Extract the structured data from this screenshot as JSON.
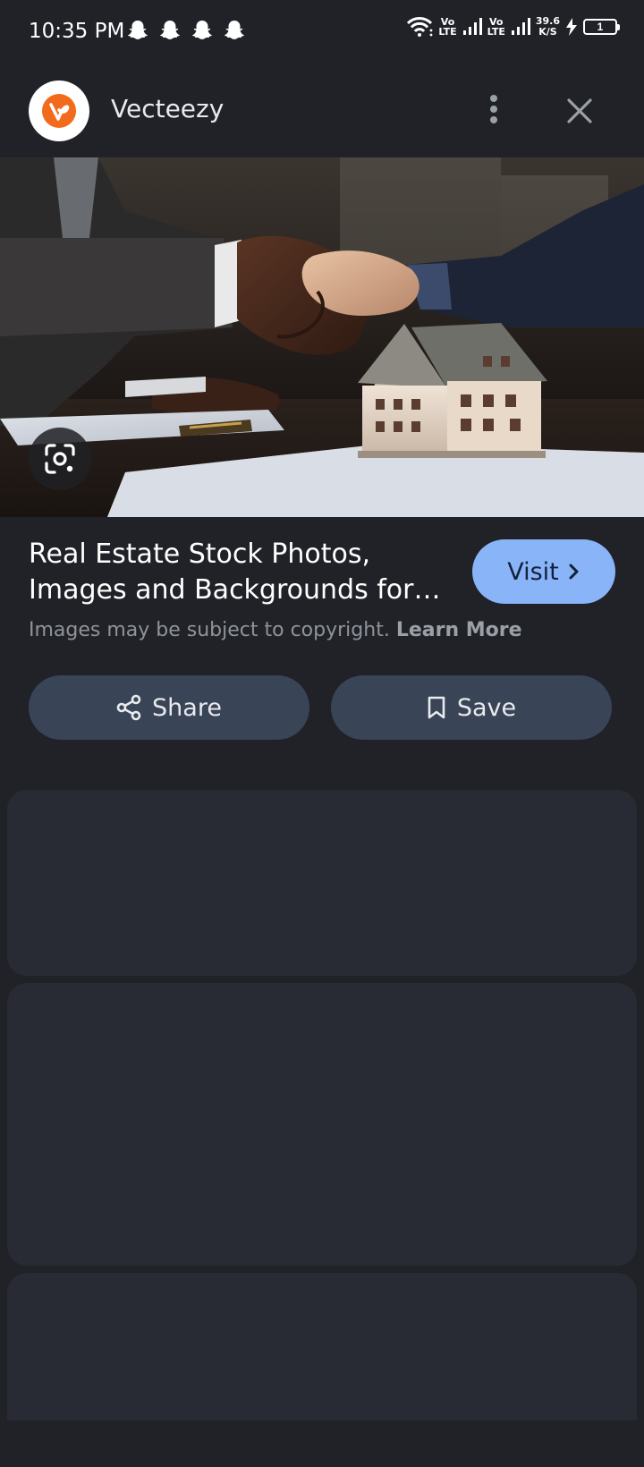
{
  "status_bar": {
    "time": "10:35 PM",
    "notification_icons": [
      "snapchat-icon",
      "snapchat-icon",
      "snapchat-icon",
      "snapchat-icon"
    ],
    "sim1": {
      "line1": "Vo",
      "line2": "LTE"
    },
    "sim2": {
      "line1": "Vo",
      "line2": "LTE"
    },
    "speed": {
      "value": "39.6",
      "unit": "K/S"
    },
    "battery": "1"
  },
  "header": {
    "site_name": "Vecteezy",
    "logo_icon": "vecteezy-logo-icon",
    "more_icon": "more-vert-icon",
    "close_icon": "close-icon"
  },
  "hero": {
    "image_description_icon": "handshake-house-photo",
    "lens_icon": "google-lens-icon"
  },
  "result": {
    "title_line1": "Real Estate Stock Photos,",
    "title_line2": "Images and Backgrounds for…",
    "visit_label": "Visit",
    "copyright_text": "Images may be subject to copyright.",
    "learn_more": "Learn More"
  },
  "actions": {
    "share_label": "Share",
    "save_label": "Save"
  },
  "colors": {
    "background": "#202228",
    "card": "#282b33",
    "visit_button": "#8ab4f8",
    "action_button": "#394457",
    "brand_orange": "#f26b1d"
  }
}
